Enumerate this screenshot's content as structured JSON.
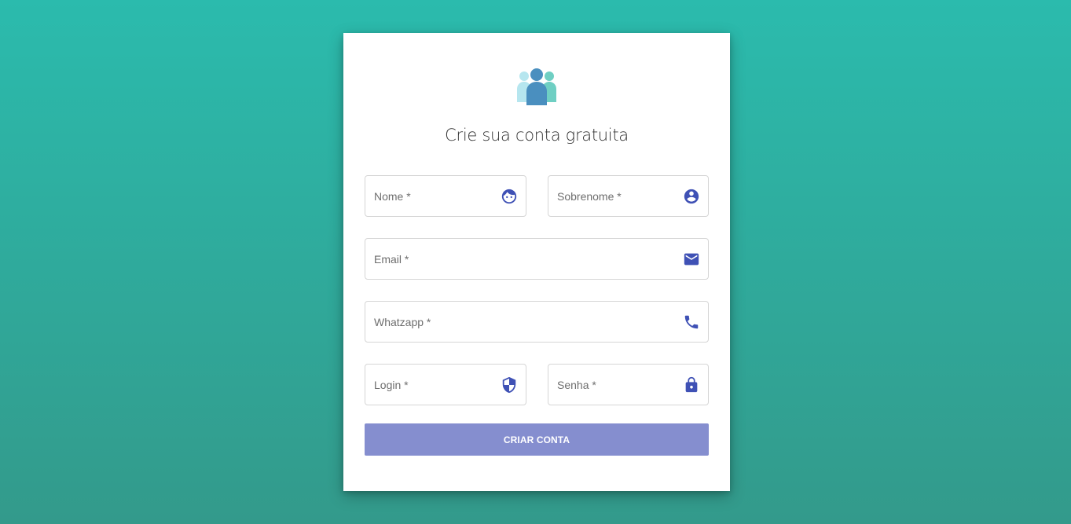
{
  "header": {
    "title": "Crie sua conta gratuita",
    "logo_icon": "users-group-icon"
  },
  "form": {
    "fields": {
      "nome": {
        "label": "Nome *",
        "value": "",
        "icon": "face-icon"
      },
      "sobrenome": {
        "label": "Sobrenome *",
        "value": "",
        "icon": "account-circle-icon"
      },
      "email": {
        "label": "Email *",
        "value": "",
        "icon": "mail-icon"
      },
      "whatsapp": {
        "label": "Whatzapp *",
        "value": "",
        "icon": "phone-icon"
      },
      "login": {
        "label": "Login *",
        "value": "",
        "icon": "shield-icon"
      },
      "senha": {
        "label": "Senha *",
        "value": "",
        "icon": "lock-icon"
      }
    },
    "submit_label": "CRIAR CONTA"
  },
  "colors": {
    "background_top": "#2bbbad",
    "background_bottom": "#339a8b",
    "icon": "#3f51b5",
    "button": "#858ecf",
    "logo_center": "#4a8fbf",
    "logo_left": "#b6e6ef",
    "logo_right": "#6fcfc3"
  }
}
